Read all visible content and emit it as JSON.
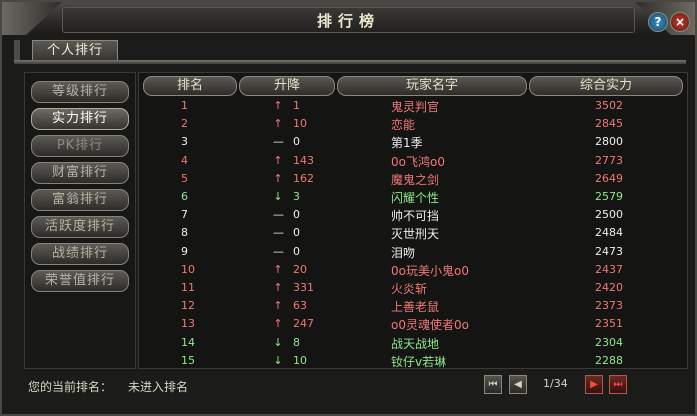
{
  "window": {
    "title": "排行榜",
    "help_glyph": "?",
    "close_glyph": "×"
  },
  "tabs": [
    {
      "label": "个人排行"
    }
  ],
  "nav": [
    {
      "label": "等级排行",
      "state": "normal"
    },
    {
      "label": "实力排行",
      "state": "active"
    },
    {
      "label": "PK排行",
      "state": "dim"
    },
    {
      "label": "财富排行",
      "state": "normal"
    },
    {
      "label": "富翁排行",
      "state": "normal"
    },
    {
      "label": "活跃度排行",
      "state": "normal"
    },
    {
      "label": "战绩排行",
      "state": "normal"
    },
    {
      "label": "荣誉值排行",
      "state": "normal"
    }
  ],
  "table": {
    "headers": {
      "rank": "排名",
      "change": "升降",
      "name": "玩家名字",
      "power": "综合实力"
    },
    "rows": [
      {
        "rank": "1",
        "arrow": "↑",
        "change": "1",
        "name": "鬼灵判官",
        "power": "3502",
        "color": "red"
      },
      {
        "rank": "2",
        "arrow": "↑",
        "change": "10",
        "name": "恋能",
        "power": "2845",
        "color": "red"
      },
      {
        "rank": "3",
        "arrow": "—",
        "change": "0",
        "name": "第1季",
        "power": "2800",
        "color": "white"
      },
      {
        "rank": "4",
        "arrow": "↑",
        "change": "143",
        "name": "0o飞鸿o0",
        "power": "2773",
        "color": "red"
      },
      {
        "rank": "5",
        "arrow": "↑",
        "change": "162",
        "name": "魔鬼之剑",
        "power": "2649",
        "color": "red"
      },
      {
        "rank": "6",
        "arrow": "↓",
        "change": "3",
        "name": "闪耀个性",
        "power": "2579",
        "color": "green"
      },
      {
        "rank": "7",
        "arrow": "—",
        "change": "0",
        "name": "帅不可挡",
        "power": "2500",
        "color": "white"
      },
      {
        "rank": "8",
        "arrow": "—",
        "change": "0",
        "name": "灭世刑天",
        "power": "2484",
        "color": "white"
      },
      {
        "rank": "9",
        "arrow": "—",
        "change": "0",
        "name": "泪吻",
        "power": "2473",
        "color": "white"
      },
      {
        "rank": "10",
        "arrow": "↑",
        "change": "20",
        "name": "0o玩美小鬼o0",
        "power": "2437",
        "color": "red"
      },
      {
        "rank": "11",
        "arrow": "↑",
        "change": "331",
        "name": "火炎斩",
        "power": "2420",
        "color": "red"
      },
      {
        "rank": "12",
        "arrow": "↑",
        "change": "63",
        "name": "上善老鼠",
        "power": "2373",
        "color": "red"
      },
      {
        "rank": "13",
        "arrow": "↑",
        "change": "247",
        "name": "o0灵魂使者0o",
        "power": "2351",
        "color": "red"
      },
      {
        "rank": "14",
        "arrow": "↓",
        "change": "8",
        "name": "战天战地",
        "power": "2304",
        "color": "green"
      },
      {
        "rank": "15",
        "arrow": "↓",
        "change": "10",
        "name": "钕仔v若琳",
        "power": "2288",
        "color": "green"
      }
    ]
  },
  "status": {
    "label": "您的当前排名：",
    "value": "未进入排名"
  },
  "pagination": {
    "page": "1/34",
    "first": "⏮",
    "prev": "◀",
    "next": "▶",
    "last": "⏭"
  },
  "colors": {
    "red": "#f07878",
    "white": "#eeeeee",
    "green": "#8ee88a",
    "frame": "#4a4842"
  }
}
